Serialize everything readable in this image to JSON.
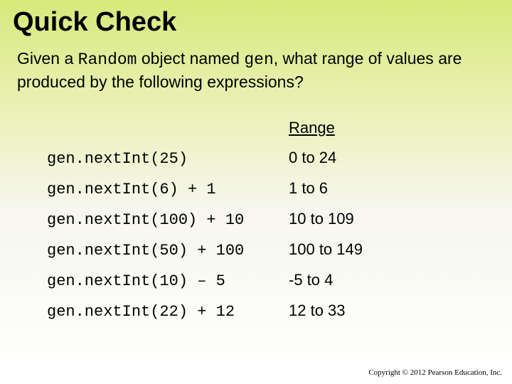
{
  "title": "Quick Check",
  "question_part1": "Given a ",
  "question_code1": "Random",
  "question_part2": " object named ",
  "question_code2": "gen",
  "question_part3": ", what range of values are produced by the following expressions?",
  "range_label": "Range",
  "rows": [
    {
      "expr": "gen.nextInt(25)",
      "range": "0 to 24"
    },
    {
      "expr": "gen.nextInt(6) + 1",
      "range": "1 to 6"
    },
    {
      "expr": "gen.nextInt(100) + 10",
      "range": "10 to 109"
    },
    {
      "expr": "gen.nextInt(50) + 100",
      "range": "100 to 149"
    },
    {
      "expr": "gen.nextInt(10) – 5",
      "range": "-5 to 4"
    },
    {
      "expr": "gen.nextInt(22) + 12",
      "range": "12 to 33"
    }
  ],
  "copyright": "Copyright © 2012 Pearson Education, Inc."
}
